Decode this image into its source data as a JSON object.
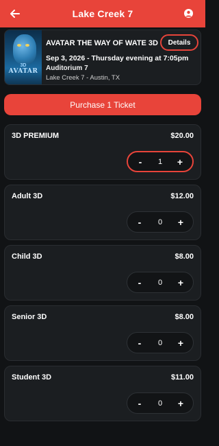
{
  "header": {
    "title": "Lake Creek 7",
    "back_icon": "arrow-left-icon",
    "account_icon": "user-avatar-icon",
    "color": "#e8443a"
  },
  "movie": {
    "title": "AVATAR THE WAY OF WATE 3D",
    "details_label": "Details",
    "showtime": "Sep 3, 2026 - Thursday evening at 7:05pm",
    "auditorium": "Auditorium 7",
    "location": "Lake Creek 7 - Austin, TX",
    "poster_text_top": "3D",
    "poster_text": "AVATAR"
  },
  "purchase": {
    "label": "Purchase 1 Ticket"
  },
  "tickets": [
    {
      "name": "3D PREMIUM",
      "price": "$20.00",
      "qty": "1",
      "minus": "-",
      "plus": "+",
      "selected": true
    },
    {
      "name": "Adult 3D",
      "price": "$12.00",
      "qty": "0",
      "minus": "-",
      "plus": "+",
      "selected": false
    },
    {
      "name": "Child 3D",
      "price": "$8.00",
      "qty": "0",
      "minus": "-",
      "plus": "+",
      "selected": false
    },
    {
      "name": "Senior 3D",
      "price": "$8.00",
      "qty": "0",
      "minus": "-",
      "plus": "+",
      "selected": false
    },
    {
      "name": "Student 3D",
      "price": "$11.00",
      "qty": "0",
      "minus": "-",
      "plus": "+",
      "selected": false
    }
  ]
}
